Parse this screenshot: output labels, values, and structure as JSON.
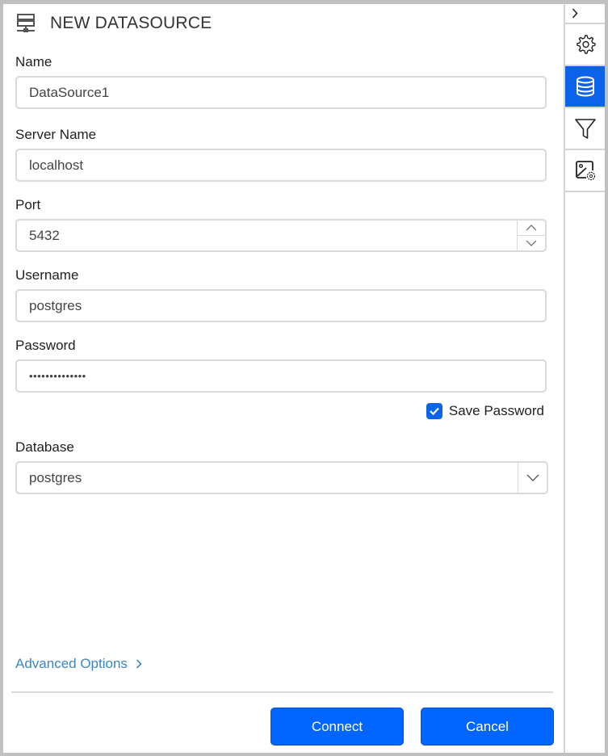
{
  "header": {
    "title": "NEW DATASOURCE",
    "icon": "server-icon"
  },
  "form": {
    "name": {
      "label": "Name",
      "value": "DataSource1"
    },
    "server_name": {
      "label": "Server Name",
      "value": "localhost"
    },
    "port": {
      "label": "Port",
      "value": "5432"
    },
    "username": {
      "label": "Username",
      "value": "postgres"
    },
    "password": {
      "label": "Password",
      "value": "••••••••••••••"
    },
    "save_password": {
      "label": "Save Password",
      "checked": true
    },
    "database": {
      "label": "Database",
      "value": "postgres"
    }
  },
  "advanced_options": {
    "label": "Advanced Options"
  },
  "buttons": {
    "connect": "Connect",
    "cancel": "Cancel"
  },
  "rail": {
    "items": [
      {
        "name": "settings",
        "icon": "gear-icon",
        "active": false
      },
      {
        "name": "datasource",
        "icon": "database-icon",
        "active": true
      },
      {
        "name": "filter",
        "icon": "filter-icon",
        "active": false
      },
      {
        "name": "image-settings",
        "icon": "image-settings-icon",
        "active": false
      }
    ]
  },
  "colors": {
    "accent": "#0066ff",
    "link": "#3a86c8",
    "border": "#d9d9d9"
  }
}
